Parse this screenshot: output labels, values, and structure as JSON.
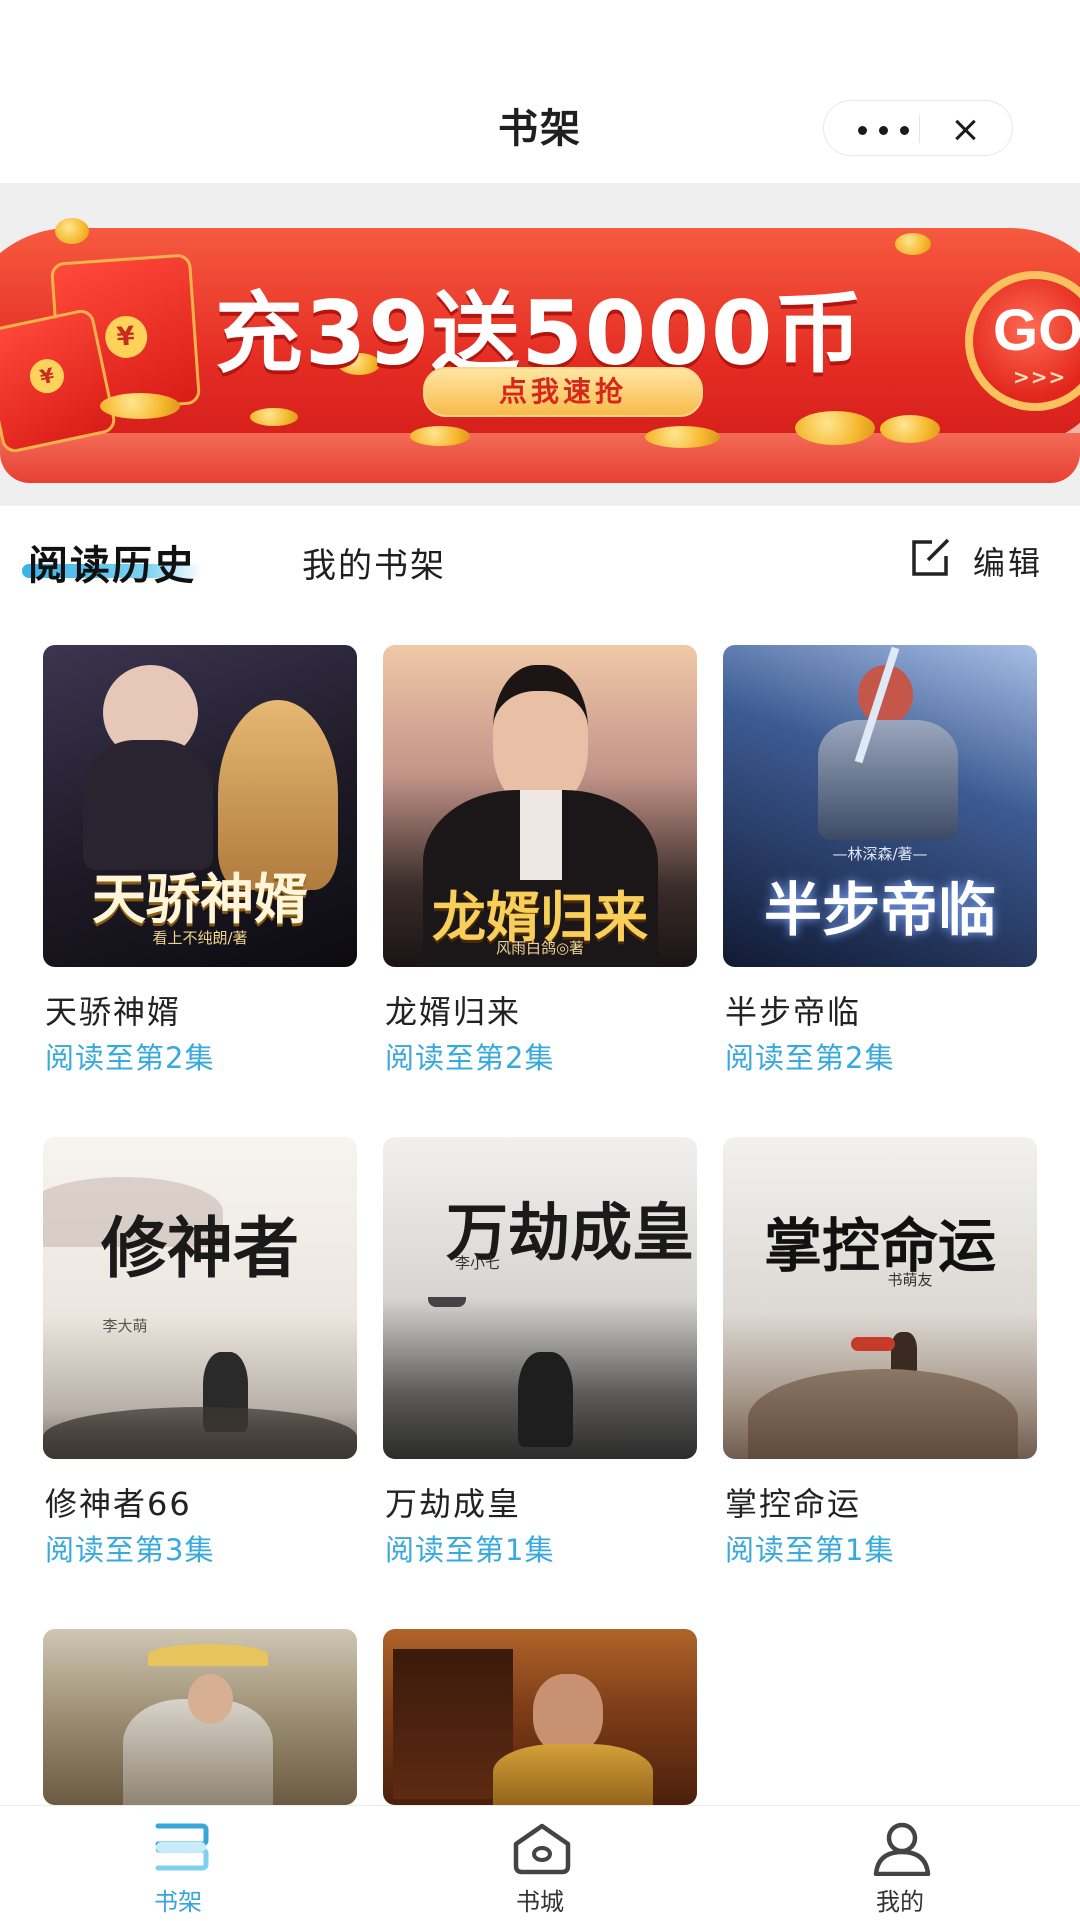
{
  "header": {
    "title": "书架"
  },
  "banner": {
    "headline": "充39送5000币",
    "cta": "点我速抢",
    "go": "GO",
    "go_arrows": ">>>",
    "envelope_symbol": "¥"
  },
  "tabs": {
    "active": "阅读历史",
    "shelf": "我的书架",
    "edit": "编辑"
  },
  "books": [
    {
      "name": "天骄神婿",
      "progress": "阅读至第2集",
      "cover_title": "天骄神婿",
      "cover_author": "看上不纯朗/著"
    },
    {
      "name": "龙婿归来",
      "progress": "阅读至第2集",
      "cover_title": "龙婿归来",
      "cover_author": "风雨白鸽◎著"
    },
    {
      "name": "半步帝临",
      "progress": "阅读至第2集",
      "cover_title": "半步帝临",
      "cover_author": "—林深森/著—"
    },
    {
      "name": "修神者66",
      "progress": "阅读至第3集",
      "cover_title": "修神者",
      "cover_author": "李大萌"
    },
    {
      "name": "万劫成皇",
      "progress": "阅读至第1集",
      "cover_title": "万劫成皇",
      "cover_author": "李小七"
    },
    {
      "name": "掌控命运",
      "progress": "阅读至第1集",
      "cover_title": "掌控命运",
      "cover_author": "书萌友"
    },
    {
      "name": "",
      "progress": "",
      "cover_title": "",
      "cover_author": ""
    },
    {
      "name": "",
      "progress": "",
      "cover_title": "",
      "cover_author": ""
    }
  ],
  "bottom_nav": {
    "items": [
      {
        "label": "书架",
        "icon": "bookshelf-icon",
        "active": true
      },
      {
        "label": "书城",
        "icon": "bookstore-icon",
        "active": false
      },
      {
        "label": "我的",
        "icon": "profile-icon",
        "active": false
      }
    ]
  },
  "colors": {
    "accent": "#37a6da",
    "banner_red": "#e52d24",
    "gold": "#f7bb4a"
  }
}
